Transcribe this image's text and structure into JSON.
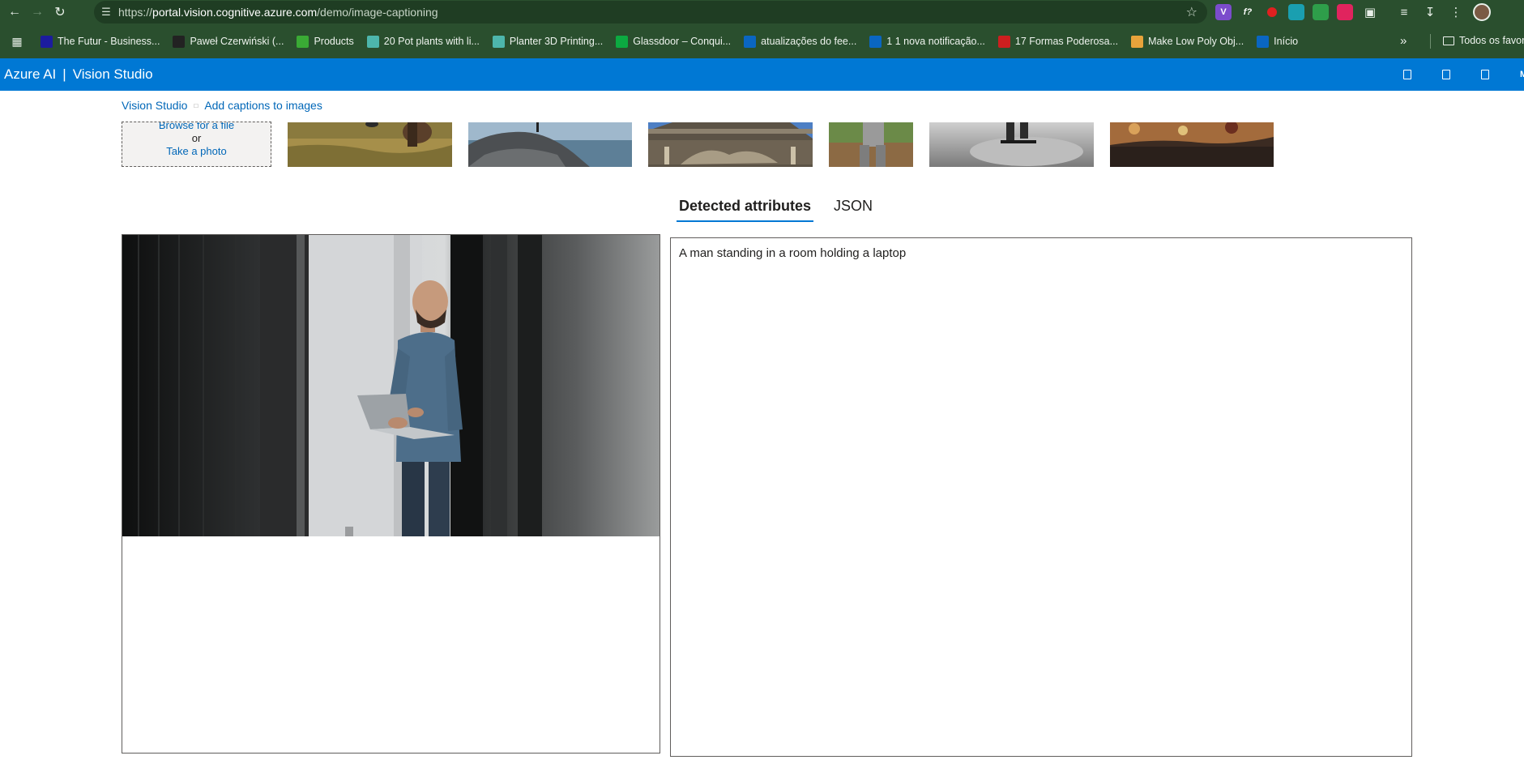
{
  "browser": {
    "url_prefix": "https://",
    "url_host": "portal.vision.cognitive.azure.com",
    "url_path": "/demo/image-captioning",
    "bookmarks": [
      {
        "label": "The Futur - Business...",
        "color": "#1c1c9e"
      },
      {
        "label": "Paweł Czerwiński (...",
        "color": "#222222"
      },
      {
        "label": "Products",
        "color": "#3aaa35"
      },
      {
        "label": "20 Pot plants with li...",
        "color": "#4db6ac"
      },
      {
        "label": "Planter 3D Printing...",
        "color": "#4db6ac"
      },
      {
        "label": "Glassdoor – Conqui...",
        "color": "#0caa41"
      },
      {
        "label": "atualizações do fee...",
        "color": "#0a66c2"
      },
      {
        "label": "1 1 nova notificação...",
        "color": "#0a66c2"
      },
      {
        "label": "17 Formas Poderosa...",
        "color": "#cc1f1f"
      },
      {
        "label": "Make Low Poly Obj...",
        "color": "#e8a33b"
      },
      {
        "label": "Início",
        "color": "#0a66c2"
      }
    ],
    "bookmarks_folder": "Todos os favor"
  },
  "header": {
    "brand": "Azure AI",
    "divider": "|",
    "product": "Vision Studio",
    "user_initial": "M",
    "color": "#0078d4"
  },
  "breadcrumb": {
    "root": "Vision Studio",
    "current": "Add captions to images"
  },
  "upload": {
    "browse": "Browse for a file",
    "or": "or",
    "photo": "Take a photo"
  },
  "tabs": [
    {
      "label": "Detected attributes",
      "active": true
    },
    {
      "label": "JSON",
      "active": false
    }
  ],
  "result": {
    "caption": "A man standing in a room holding a laptop"
  }
}
